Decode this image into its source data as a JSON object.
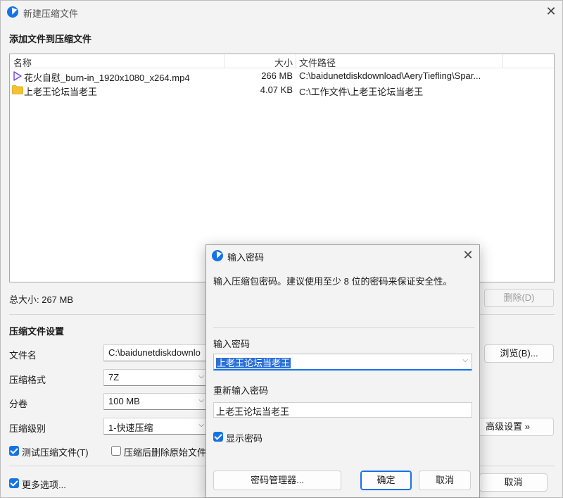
{
  "main": {
    "title": "新建压缩文件",
    "add_heading": "添加文件到压缩文件",
    "columns": {
      "name": "名称",
      "size": "大小",
      "path": "文件路径"
    },
    "files": [
      {
        "icon": "video-file-icon",
        "name": "花火自慰_burn-in_1920x1080_x264.mp4",
        "size": "266 MB",
        "path": "C:\\baidunetdiskdownload\\AeryTiefling\\Spar..."
      },
      {
        "icon": "folder-icon",
        "name": "上老王论坛当老王",
        "size": "4.07 KB",
        "path": "C:\\工作文件\\上老王论坛当老王"
      }
    ],
    "total_size": "总大小: 267 MB",
    "delete_label": "删除(D)",
    "settings_heading": "压缩文件设置",
    "filename_label": "文件名",
    "filename_value": "C:\\baidunetdiskdownlo",
    "browse_label": "浏览(B)...",
    "format_label": "压缩格式",
    "format_value": "7Z",
    "volume_label": "分卷",
    "volume_value": "100 MB",
    "level_label": "压缩级别",
    "level_value": "1-快速压缩",
    "advanced_label": "高级设置 »",
    "test_label": "测试压缩文件(T)",
    "test_checked": true,
    "delete_after_label": "压缩后删除原始文件",
    "delete_after_checked": false,
    "more_options_label": "更多选项...",
    "more_options_checked": true,
    "cancel_label": "取消"
  },
  "dialog": {
    "title": "输入密码",
    "description": "输入压缩包密码。建议使用至少 8 位的密码来保证安全性。",
    "password_label": "输入密码",
    "password_value": "上老王论坛当老王",
    "reenter_label": "重新输入密码",
    "reenter_value": "上老王论坛当老王",
    "show_password_label": "显示密码",
    "show_password_checked": true,
    "manager_label": "密码管理器...",
    "ok_label": "确定",
    "cancel_label": "取消"
  },
  "colors": {
    "accent": "#1673e6",
    "selection": "#2b6fd6",
    "video_icon": "#6b4fc8",
    "folder_icon": "#f2c230"
  }
}
